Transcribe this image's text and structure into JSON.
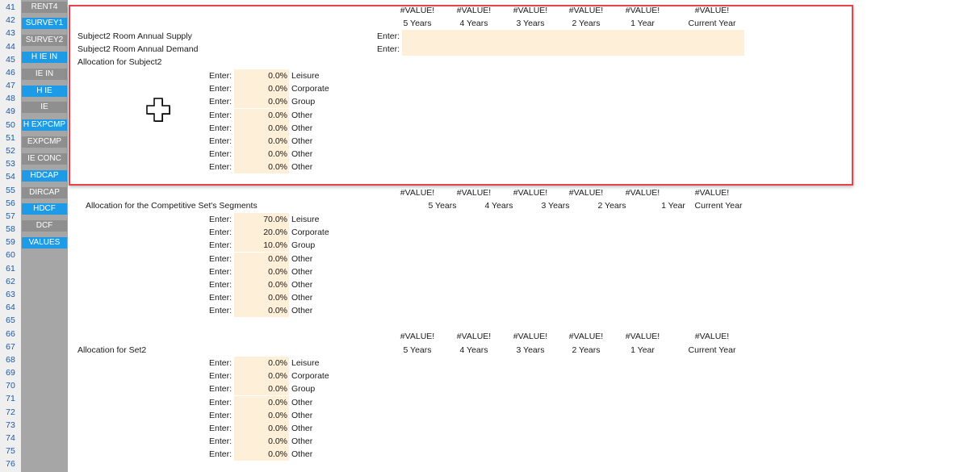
{
  "row_numbers": [
    "41",
    "42",
    "43",
    "44",
    "45",
    "46",
    "47",
    "48",
    "49",
    "50",
    "51",
    "52",
    "53",
    "54",
    "55",
    "56",
    "57",
    "58",
    "59",
    "60",
    "61",
    "62",
    "63",
    "64",
    "65",
    "66",
    "67",
    "68",
    "69",
    "70",
    "71",
    "72",
    "73",
    "74",
    "75",
    "76"
  ],
  "sidebar": {
    "items": [
      {
        "label": "RENT4",
        "style": "gray"
      },
      {
        "label": "SURVEY1",
        "style": "blue"
      },
      {
        "label": "SURVEY2",
        "style": "gray"
      },
      {
        "label": "H IE IN",
        "style": "blue"
      },
      {
        "label": "IE IN",
        "style": "gray"
      },
      {
        "label": "H IE",
        "style": "blue"
      },
      {
        "label": "IE",
        "style": "gray"
      },
      {
        "label": "H EXPCMP",
        "style": "blue"
      },
      {
        "label": "EXPCMP",
        "style": "gray"
      },
      {
        "label": "IE CONC",
        "style": "gray"
      },
      {
        "label": "HDCAP",
        "style": "blue"
      },
      {
        "label": "DIRCAP",
        "style": "gray"
      },
      {
        "label": "HDCF",
        "style": "blue"
      },
      {
        "label": "DCF",
        "style": "gray"
      },
      {
        "label": "VALUES",
        "style": "blue"
      }
    ]
  },
  "year_headers": [
    "5 Years",
    "4 Years",
    "3 Years",
    "2 Years",
    "1 Year",
    "Current Year"
  ],
  "value_error": "#VALUE!",
  "enter_label": "Enter:",
  "section1": {
    "supply_label": "Subject2 Room Annual Supply",
    "demand_label": "Subject2 Room Annual Demand",
    "allocation_title": "Allocation for Subject2",
    "rows": [
      {
        "value": "0.0%",
        "segment": "Leisure"
      },
      {
        "value": "0.0%",
        "segment": "Corporate"
      },
      {
        "value": "0.0%",
        "segment": "Group"
      },
      {
        "value": "0.0%",
        "segment": "Other"
      },
      {
        "value": "0.0%",
        "segment": "Other"
      },
      {
        "value": "0.0%",
        "segment": "Other"
      },
      {
        "value": "0.0%",
        "segment": "Other"
      },
      {
        "value": "0.0%",
        "segment": "Other"
      }
    ]
  },
  "section2": {
    "allocation_title": "Allocation for the Competitive Set's Segments",
    "rows": [
      {
        "value": "70.0%",
        "segment": "Leisure"
      },
      {
        "value": "20.0%",
        "segment": "Corporate"
      },
      {
        "value": "10.0%",
        "segment": "Group"
      },
      {
        "value": "0.0%",
        "segment": "Other"
      },
      {
        "value": "0.0%",
        "segment": "Other"
      },
      {
        "value": "0.0%",
        "segment": "Other"
      },
      {
        "value": "0.0%",
        "segment": "Other"
      },
      {
        "value": "0.0%",
        "segment": "Other"
      }
    ]
  },
  "section3": {
    "allocation_title": "Allocation for Set2",
    "rows": [
      {
        "value": "0.0%",
        "segment": "Leisure"
      },
      {
        "value": "0.0%",
        "segment": "Corporate"
      },
      {
        "value": "0.0%",
        "segment": "Group"
      },
      {
        "value": "0.0%",
        "segment": "Other"
      },
      {
        "value": "0.0%",
        "segment": "Other"
      },
      {
        "value": "0.0%",
        "segment": "Other"
      },
      {
        "value": "0.0%",
        "segment": "Other"
      },
      {
        "value": "0.0%",
        "segment": "Other"
      }
    ]
  },
  "colors": {
    "input_fill": "#fdefd8",
    "sidebar_blue": "#1e9be6",
    "sidebar_gray": "#8f8f8f",
    "highlight_border": "#e8434a",
    "row_number": "#1a5aa5"
  },
  "icons": {
    "cursor": "plus-cursor-icon"
  }
}
